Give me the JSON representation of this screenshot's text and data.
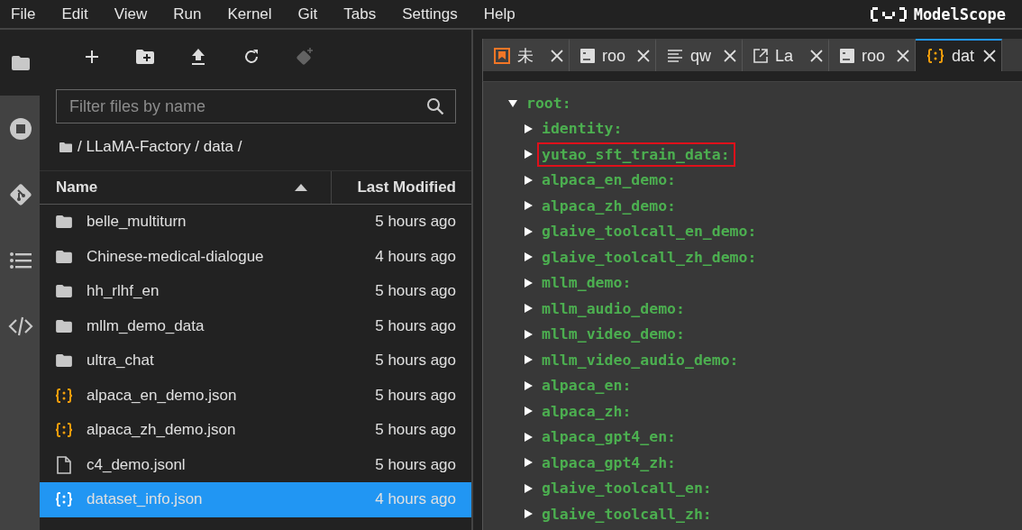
{
  "menu_bar": {
    "items": [
      "File",
      "Edit",
      "View",
      "Run",
      "Kernel",
      "Git",
      "Tabs",
      "Settings",
      "Help"
    ],
    "logo": "ModelScope"
  },
  "activity_bar": {
    "items": [
      {
        "kind": "folder",
        "selected": true
      },
      {
        "kind": "stop",
        "selected": false
      },
      {
        "kind": "git",
        "selected": false
      },
      {
        "kind": "list",
        "selected": false
      },
      {
        "kind": "code",
        "selected": false
      }
    ]
  },
  "file_browser": {
    "toolbar": [
      {
        "kind": "new",
        "disabled": false
      },
      {
        "kind": "new-folder",
        "disabled": false
      },
      {
        "kind": "upload",
        "disabled": false
      },
      {
        "kind": "refresh",
        "disabled": false
      },
      {
        "kind": "git-clone",
        "disabled": true
      }
    ],
    "filter": {
      "placeholder": "Filter files by name"
    },
    "breadcrumb": "/ LLaMA-Factory / data /",
    "columns": [
      "Name",
      "Last Modified"
    ],
    "rows": [
      {
        "kind": "folder",
        "name": "belle_multiturn",
        "modified": "5 hours ago",
        "selected": false
      },
      {
        "kind": "folder",
        "name": "Chinese-medical-dialogue",
        "modified": "4 hours ago",
        "selected": false
      },
      {
        "kind": "folder",
        "name": "hh_rlhf_en",
        "modified": "5 hours ago",
        "selected": false
      },
      {
        "kind": "folder",
        "name": "mllm_demo_data",
        "modified": "5 hours ago",
        "selected": false
      },
      {
        "kind": "folder",
        "name": "ultra_chat",
        "modified": "5 hours ago",
        "selected": false
      },
      {
        "kind": "json",
        "name": "alpaca_en_demo.json",
        "modified": "5 hours ago",
        "selected": false
      },
      {
        "kind": "json",
        "name": "alpaca_zh_demo.json",
        "modified": "5 hours ago",
        "selected": false
      },
      {
        "kind": "file",
        "name": "c4_demo.jsonl",
        "modified": "5 hours ago",
        "selected": false
      },
      {
        "kind": "json",
        "name": "dataset_info.json",
        "modified": "4 hours ago",
        "selected": true
      }
    ]
  },
  "editor": {
    "tabs": [
      {
        "kind": "notebook",
        "label": "未",
        "selected": false
      },
      {
        "kind": "terminal",
        "label": "roo",
        "selected": false
      },
      {
        "kind": "text",
        "label": "qw",
        "selected": false
      },
      {
        "kind": "launcher",
        "label": "La",
        "selected": false
      },
      {
        "kind": "terminal",
        "label": "roo",
        "selected": false
      },
      {
        "kind": "json",
        "label": "dat",
        "selected": true
      }
    ],
    "tree": {
      "label": "root:",
      "expanded": true,
      "children": [
        {
          "label": "identity:",
          "expanded": false,
          "highlighted": false
        },
        {
          "label": "yutao_sft_train_data:",
          "expanded": false,
          "highlighted": true
        },
        {
          "label": "alpaca_en_demo:",
          "expanded": false,
          "highlighted": false
        },
        {
          "label": "alpaca_zh_demo:",
          "expanded": false,
          "highlighted": false
        },
        {
          "label": "glaive_toolcall_en_demo:",
          "expanded": false,
          "highlighted": false
        },
        {
          "label": "glaive_toolcall_zh_demo:",
          "expanded": false,
          "highlighted": false
        },
        {
          "label": "mllm_demo:",
          "expanded": false,
          "highlighted": false
        },
        {
          "label": "mllm_audio_demo:",
          "expanded": false,
          "highlighted": false
        },
        {
          "label": "mllm_video_demo:",
          "expanded": false,
          "highlighted": false
        },
        {
          "label": "mllm_video_audio_demo:",
          "expanded": false,
          "highlighted": false
        },
        {
          "label": "alpaca_en:",
          "expanded": false,
          "highlighted": false
        },
        {
          "label": "alpaca_zh:",
          "expanded": false,
          "highlighted": false
        },
        {
          "label": "alpaca_gpt4_en:",
          "expanded": false,
          "highlighted": false
        },
        {
          "label": "alpaca_gpt4_zh:",
          "expanded": false,
          "highlighted": false
        },
        {
          "label": "glaive_toolcall_en:",
          "expanded": false,
          "highlighted": false
        },
        {
          "label": "glaive_toolcall_zh:",
          "expanded": false,
          "highlighted": false
        }
      ]
    }
  }
}
